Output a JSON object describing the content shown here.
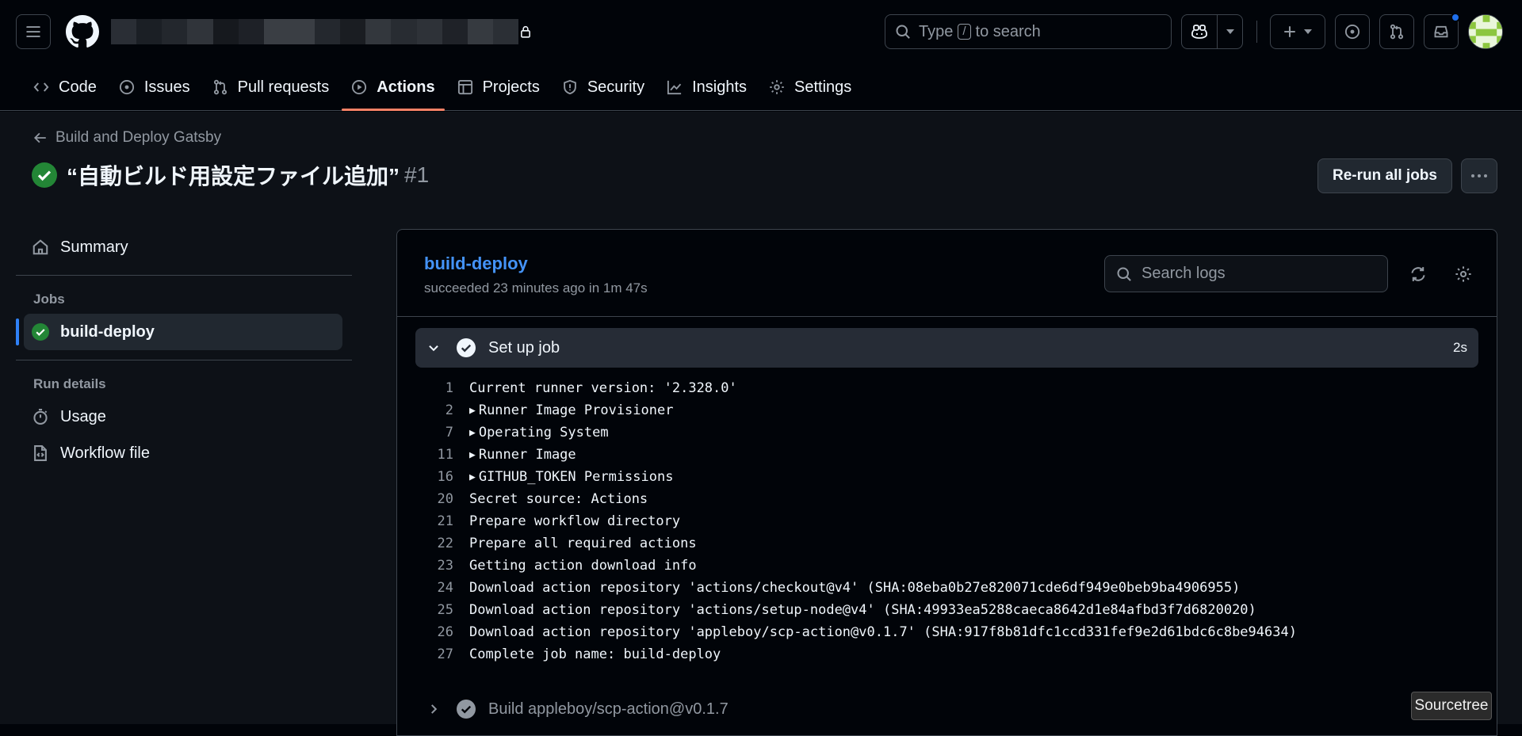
{
  "header": {
    "menu_icon": "hamburger-icon",
    "logo_icon": "github-mark-icon",
    "search": {
      "prefix": "Type",
      "key": "/",
      "suffix": "to search"
    },
    "copilot_icon": "copilot-icon",
    "create_icon": "plus-icon",
    "issues_icon": "issue-opened-icon",
    "pulls_icon": "git-pull-request-icon",
    "inbox_icon": "inbox-icon"
  },
  "nav": {
    "items": [
      {
        "label": "Code",
        "icon": "code-icon"
      },
      {
        "label": "Issues",
        "icon": "issue-opened-icon"
      },
      {
        "label": "Pull requests",
        "icon": "git-pull-request-icon"
      },
      {
        "label": "Actions",
        "icon": "play-icon",
        "active": true
      },
      {
        "label": "Projects",
        "icon": "table-icon"
      },
      {
        "label": "Security",
        "icon": "shield-icon"
      },
      {
        "label": "Insights",
        "icon": "graph-icon"
      },
      {
        "label": "Settings",
        "icon": "gear-icon"
      }
    ]
  },
  "run": {
    "back_label": "Build and Deploy Gatsby",
    "title": "“自動ビルド用設定ファイル追加”",
    "number": "#1",
    "rerun_label": "Re-run all jobs"
  },
  "sidebar": {
    "summary_label": "Summary",
    "jobs_heading": "Jobs",
    "job_label": "build-deploy",
    "run_details_heading": "Run details",
    "usage_label": "Usage",
    "workflow_label": "Workflow file"
  },
  "job": {
    "name": "build-deploy",
    "status": "succeeded 23 minutes ago in 1m 47s",
    "search_placeholder": "Search logs",
    "step1": {
      "name": "Set up job",
      "duration": "2s"
    },
    "step2": {
      "name": "Build appleboy/scp-action@v0.1.7"
    },
    "log": [
      {
        "n": "1",
        "text": "Current runner version: '2.328.0'",
        "group": false
      },
      {
        "n": "2",
        "text": "Runner Image Provisioner",
        "group": true
      },
      {
        "n": "7",
        "text": "Operating System",
        "group": true
      },
      {
        "n": "11",
        "text": "Runner Image",
        "group": true
      },
      {
        "n": "16",
        "text": "GITHUB_TOKEN Permissions",
        "group": true
      },
      {
        "n": "20",
        "text": "Secret source: Actions",
        "group": false
      },
      {
        "n": "21",
        "text": "Prepare workflow directory",
        "group": false
      },
      {
        "n": "22",
        "text": "Prepare all required actions",
        "group": false
      },
      {
        "n": "23",
        "text": "Getting action download info",
        "group": false
      },
      {
        "n": "24",
        "text": "Download action repository 'actions/checkout@v4' (SHA:08eba0b27e820071cde6df949e0beb9ba4906955)",
        "group": false
      },
      {
        "n": "25",
        "text": "Download action repository 'actions/setup-node@v4' (SHA:49933ea5288caeca8642d1e84afbd3f7d6820020)",
        "group": false
      },
      {
        "n": "26",
        "text": "Download action repository 'appleboy/scp-action@v0.1.7' (SHA:917f8b81dfc1ccd331fef9e2d61bdc6c8be94634)",
        "group": false
      },
      {
        "n": "27",
        "text": "Complete job name: build-deploy",
        "group": false
      }
    ]
  },
  "tooltip": {
    "label": "Sourcetree"
  },
  "colors": {
    "success": "#238636",
    "accent_link": "#4493f8",
    "tab_underline": "#f78166"
  }
}
